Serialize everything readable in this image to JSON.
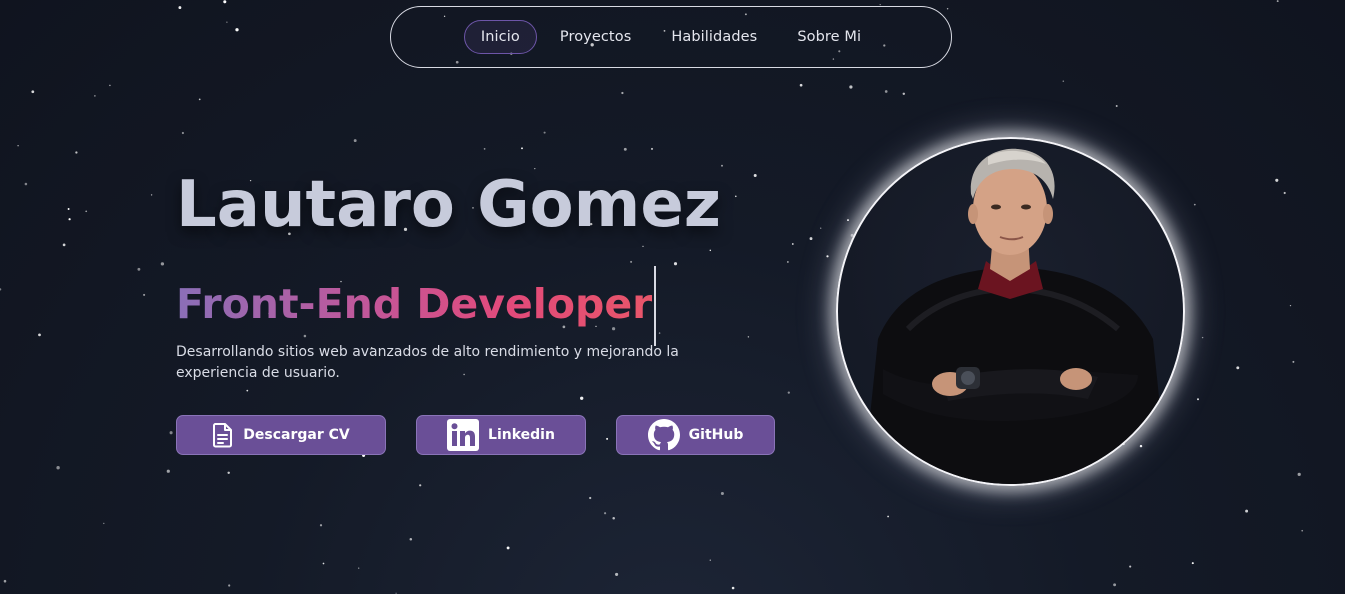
{
  "nav": {
    "items": [
      {
        "label": "Inicio",
        "active": true
      },
      {
        "label": "Proyectos",
        "active": false
      },
      {
        "label": "Habilidades",
        "active": false
      },
      {
        "label": "Sobre Mi",
        "active": false
      }
    ]
  },
  "hero": {
    "name": "Lautaro Gomez",
    "role": "Front-End Developer",
    "description": "Desarrollando sitios web avanzados de alto rendimiento y mejorando la experiencia de usuario.",
    "buttons": {
      "cv": {
        "label": "Descargar CV",
        "icon": "document-icon"
      },
      "linkedin": {
        "label": "Linkedin",
        "icon": "linkedin-icon"
      },
      "github": {
        "label": "GitHub",
        "icon": "github-icon"
      }
    }
  },
  "avatar": {
    "description_icon": "profile-photo"
  },
  "colors": {
    "background": "#141a27",
    "button": "#6a4f97",
    "name": "#c7cbdb",
    "gradient_start": "#8a6fb8",
    "gradient_end": "#e8566a"
  }
}
